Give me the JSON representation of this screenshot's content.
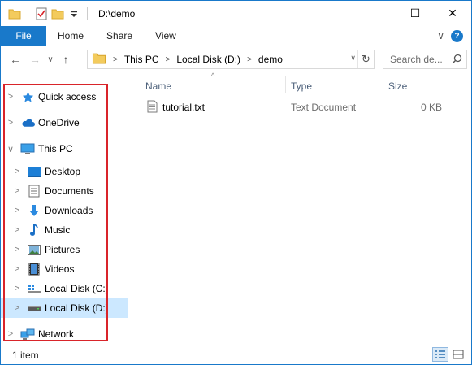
{
  "window": {
    "title": "D:\\demo",
    "caption_buttons": {
      "minimize": "—",
      "maximize": "☐",
      "close": "✕"
    }
  },
  "ribbon": {
    "tabs": [
      "File",
      "Home",
      "Share",
      "View"
    ],
    "expand_glyph": "∨",
    "help_glyph": "?"
  },
  "navigation": {
    "back": "←",
    "forward": "→",
    "recent": "∨",
    "up": "↑"
  },
  "address": {
    "crumbs": [
      "This PC",
      "Local Disk (D:)",
      "demo"
    ],
    "dropdown_glyph": "∨",
    "refresh_glyph": "↻"
  },
  "search": {
    "placeholder": "Search de..."
  },
  "sidebar": {
    "items": [
      {
        "label": "Quick access",
        "icon": "star-icon",
        "level": 0,
        "expander": ">",
        "selected": false
      },
      {
        "label": "OneDrive",
        "icon": "cloud-icon",
        "level": 0,
        "expander": ">",
        "selected": false
      },
      {
        "label": "This PC",
        "icon": "computer-icon",
        "level": 0,
        "expander": "∨",
        "selected": false
      },
      {
        "label": "Desktop",
        "icon": "desktop-icon",
        "level": 1,
        "expander": ">",
        "selected": false
      },
      {
        "label": "Documents",
        "icon": "documents-icon",
        "level": 1,
        "expander": ">",
        "selected": false
      },
      {
        "label": "Downloads",
        "icon": "download-icon",
        "level": 1,
        "expander": ">",
        "selected": false
      },
      {
        "label": "Music",
        "icon": "music-icon",
        "level": 1,
        "expander": ">",
        "selected": false
      },
      {
        "label": "Pictures",
        "icon": "pictures-icon",
        "level": 1,
        "expander": ">",
        "selected": false
      },
      {
        "label": "Videos",
        "icon": "videos-icon",
        "level": 1,
        "expander": ">",
        "selected": false
      },
      {
        "label": "Local Disk (C:)",
        "icon": "windows-drive-icon",
        "level": 1,
        "expander": ">",
        "selected": false
      },
      {
        "label": "Local Disk (D:)",
        "icon": "drive-icon",
        "level": 1,
        "expander": ">",
        "selected": true
      },
      {
        "label": "Network",
        "icon": "network-icon",
        "level": 0,
        "expander": ">",
        "selected": false
      }
    ]
  },
  "files": {
    "sort_glyph": "^",
    "columns": [
      "Name",
      "Type",
      "Size"
    ],
    "rows": [
      {
        "name": "tutorial.txt",
        "type": "Text Document",
        "size": "0 KB",
        "icon": "text-file-icon"
      }
    ]
  },
  "status": {
    "item_count": "1 item"
  },
  "colors": {
    "accent": "#1979ca",
    "selection": "#cce8ff",
    "highlight_border": "#d9242a"
  }
}
